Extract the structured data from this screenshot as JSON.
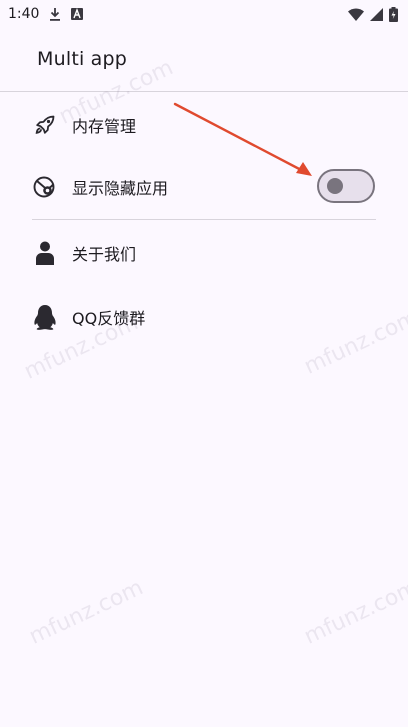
{
  "status_bar": {
    "time": "1:40",
    "icons": [
      "download-icon",
      "a-badge-icon",
      "wifi-icon",
      "signal-icon",
      "battery-icon"
    ]
  },
  "app_bar": {
    "title": "Multi app"
  },
  "menu": [
    {
      "label": "内存管理",
      "icon": "rocket-icon"
    },
    {
      "label": "显示隐藏应用",
      "icon": "eye-hidden-icon",
      "toggle": {
        "on": false
      }
    },
    {
      "label": "关于我们",
      "icon": "person-icon"
    },
    {
      "label": "QQ反馈群",
      "icon": "qq-penguin-icon"
    }
  ],
  "watermark": "mfunz.com",
  "colors": {
    "background": "#fcf8ff",
    "annotation_arrow": "#e04a2f",
    "toggle_outline": "#79747e"
  }
}
